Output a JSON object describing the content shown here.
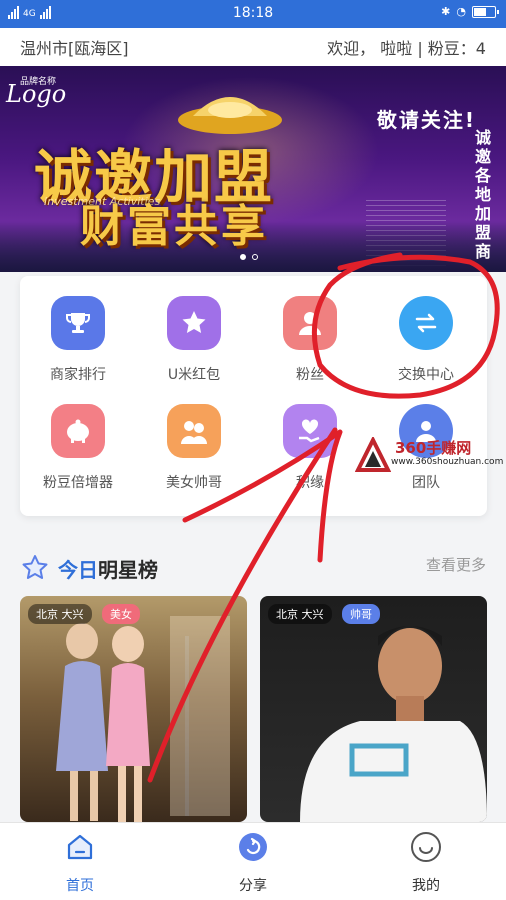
{
  "statusbar": {
    "network": "4G",
    "time": "18:18"
  },
  "header": {
    "location": "温州市[瓯海区]",
    "greeting": "欢迎， 啦啦 | 粉豆：4"
  },
  "banner": {
    "logo_sub": "品牌名称",
    "logo": "Logo",
    "headline_1": "诚邀加盟",
    "subtitle": "Investment Activities",
    "headline_2": "财富共享",
    "follow": "敬请关注!",
    "vertical": "诚邀各地加盟商"
  },
  "grid": [
    {
      "label": "商家排行",
      "icon": "trophy-icon",
      "color": "#5a78e8"
    },
    {
      "label": "U米红包",
      "icon": "star-icon",
      "color": "#a070e8"
    },
    {
      "label": "粉丝",
      "icon": "user-icon",
      "color": "#f08080"
    },
    {
      "label": "交换中心",
      "icon": "exchange-icon",
      "color": "#3aa6f2"
    },
    {
      "label": "粉豆倍增器",
      "icon": "piggy-bank-icon",
      "color": "#f37f86"
    },
    {
      "label": "美女帅哥",
      "icon": "couple-icon",
      "color": "#f6a15a"
    },
    {
      "label": "积缘",
      "icon": "heart-hand-icon",
      "color": "#b283ef"
    },
    {
      "label": "团队",
      "icon": "team-icon",
      "color": "#5b7fe8"
    }
  ],
  "section": {
    "title_blue": "今日",
    "title_rest": "明星榜",
    "more": "查看更多"
  },
  "cards": [
    {
      "location": "北京 大兴",
      "type": "美女",
      "type_color": "#f06b7a"
    },
    {
      "location": "北京 大兴",
      "type": "帅哥",
      "type_color": "#5b7fe8"
    }
  ],
  "watermark": {
    "title": "360手赚网",
    "url": "www.360shouzhuan.com"
  },
  "nav": [
    {
      "label": "首页",
      "icon": "home-icon",
      "active": true
    },
    {
      "label": "分享",
      "icon": "share-icon",
      "active": false
    },
    {
      "label": "我的",
      "icon": "profile-icon",
      "active": false
    }
  ],
  "colors": {
    "accent": "#2f6fd8",
    "annotation": "#e0202a"
  }
}
